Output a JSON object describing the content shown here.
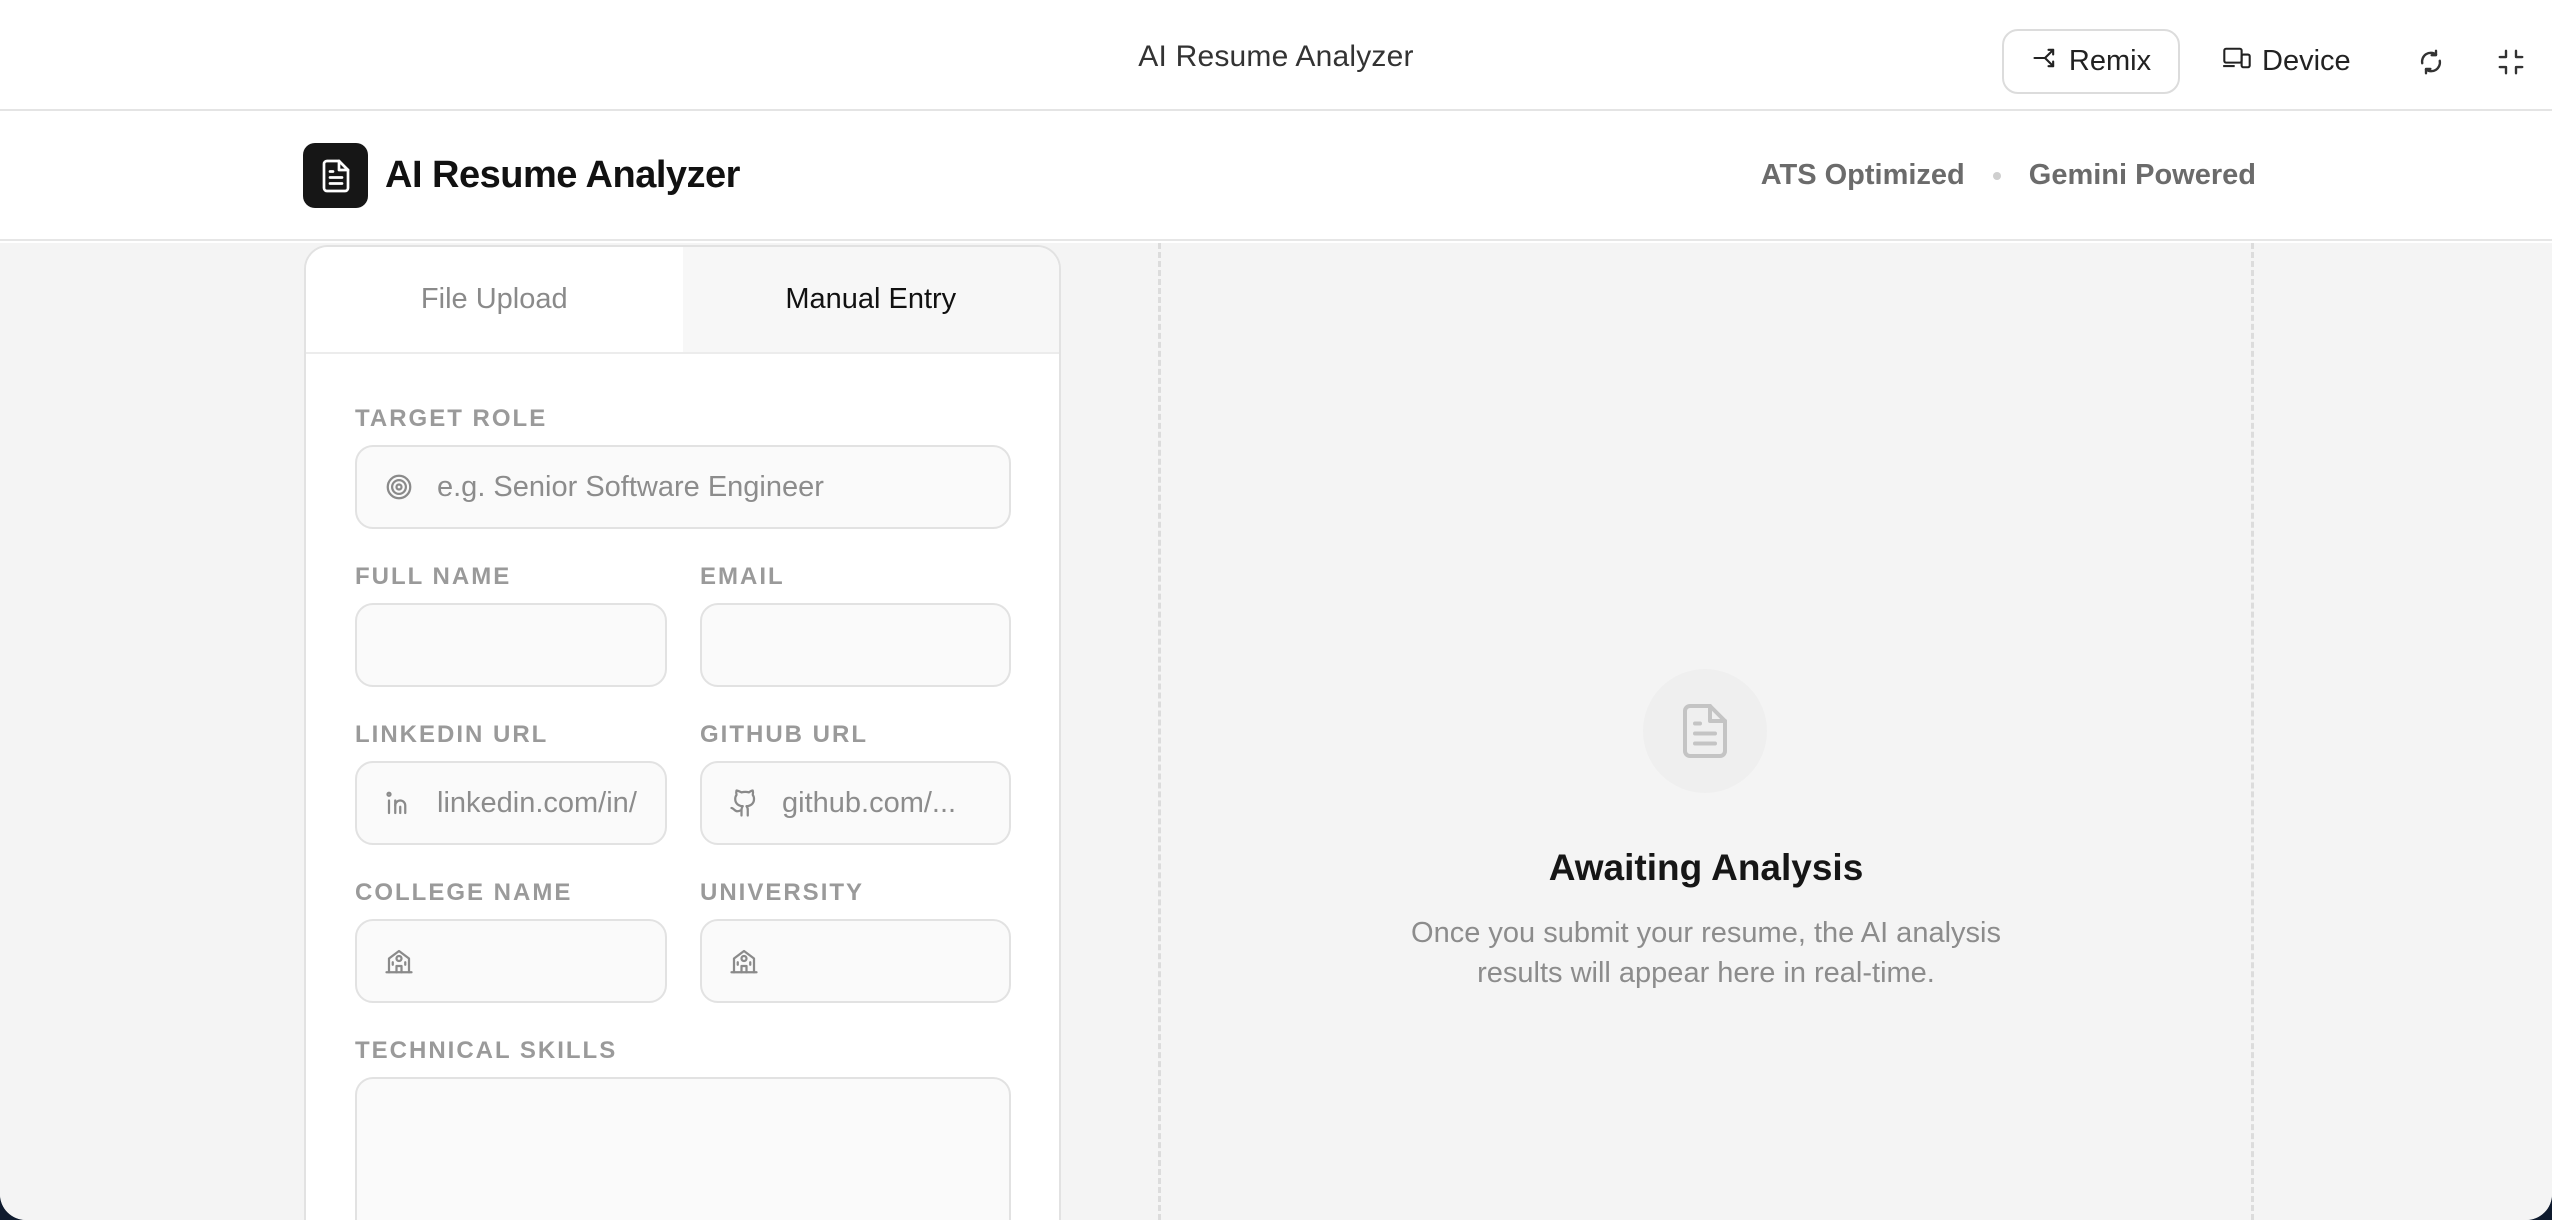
{
  "topbar": {
    "title": "AI Resume Analyzer",
    "remix_label": "Remix",
    "device_label": "Device"
  },
  "header": {
    "app_title": "AI Resume Analyzer",
    "badges": [
      "ATS Optimized",
      "Gemini Powered"
    ]
  },
  "tabs": [
    {
      "label": "File Upload",
      "active": false
    },
    {
      "label": "Manual Entry",
      "active": true
    }
  ],
  "form": {
    "target_role": {
      "label": "TARGET ROLE",
      "placeholder": "e.g. Senior Software Engineer",
      "value": ""
    },
    "full_name": {
      "label": "FULL NAME",
      "value": ""
    },
    "email": {
      "label": "EMAIL",
      "value": ""
    },
    "linkedin": {
      "label": "LINKEDIN URL",
      "placeholder": "linkedin.com/in/",
      "value": ""
    },
    "github": {
      "label": "GITHUB URL",
      "placeholder": "github.com/...",
      "value": ""
    },
    "college": {
      "label": "COLLEGE NAME",
      "value": ""
    },
    "university": {
      "label": "UNIVERSITY",
      "value": ""
    },
    "skills": {
      "label": "TECHNICAL SKILLS",
      "value": ""
    }
  },
  "results": {
    "title": "Awaiting Analysis",
    "subtitle_line1": "Once you submit your resume, the AI analysis",
    "subtitle_line2": "results will appear here in real-time."
  },
  "colors": {
    "accent": "#161616",
    "muted_text": "#8c8c8c",
    "panel_bg": "#f4f4f4"
  }
}
